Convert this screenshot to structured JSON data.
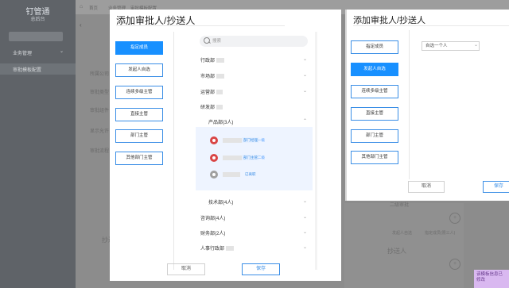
{
  "backdrop": {
    "brand": "钉管通",
    "brand_sub": "总后台",
    "side_search": "",
    "side_group": "业务管理",
    "side_active": "审批模板配置",
    "crumbs": [
      "首页",
      "业务管理",
      "审批模板配置"
    ],
    "row_labels": [
      "所属公司",
      "审批类型",
      "审批组件",
      "显示允许",
      "审批流程"
    ],
    "bottom_labels": [
      "抄送人",
      "抄送人"
    ],
    "right_labels": [
      "二级审批",
      "发起人自选",
      "指定成员(限三人)"
    ],
    "hint": "该模板信息已修改"
  },
  "dialog_left": {
    "title": "添加审批人/抄送人",
    "options": [
      "指定成员",
      "发起人自选",
      "连续多级主管",
      "直接主管",
      "部门主管",
      "其他部门主管"
    ],
    "active_index": 0,
    "search_placeholder": "搜索",
    "tree": [
      {
        "label": "行政部",
        "expanded": false
      },
      {
        "label": "市场部",
        "expanded": false
      },
      {
        "label": "运营部",
        "expanded": false
      },
      {
        "label": "研发部",
        "expanded": true
      }
    ],
    "subdept": {
      "label": "产品部(3人)",
      "expanded": true
    },
    "members": [
      {
        "tag": "部门经理",
        "badge": "一级"
      },
      {
        "tag": "部门主管",
        "badge": "二级"
      },
      {
        "tag": "",
        "badge": "已离职"
      }
    ],
    "tree_after": [
      {
        "label": "技术部(4人)"
      },
      {
        "label": "咨询部(4人)"
      },
      {
        "label": "财务部(2人)"
      },
      {
        "label": "人事行政部"
      }
    ],
    "cancel": "取消",
    "save": "保存"
  },
  "dialog_right": {
    "title": "添加审批人/抄送人",
    "options": [
      "指定成员",
      "发起人自选",
      "连续多级主管",
      "直接主管",
      "部门主管",
      "其他部门主管"
    ],
    "active_index": 1,
    "select_value": "自选一个人",
    "cancel": "取消",
    "save": "保存"
  }
}
